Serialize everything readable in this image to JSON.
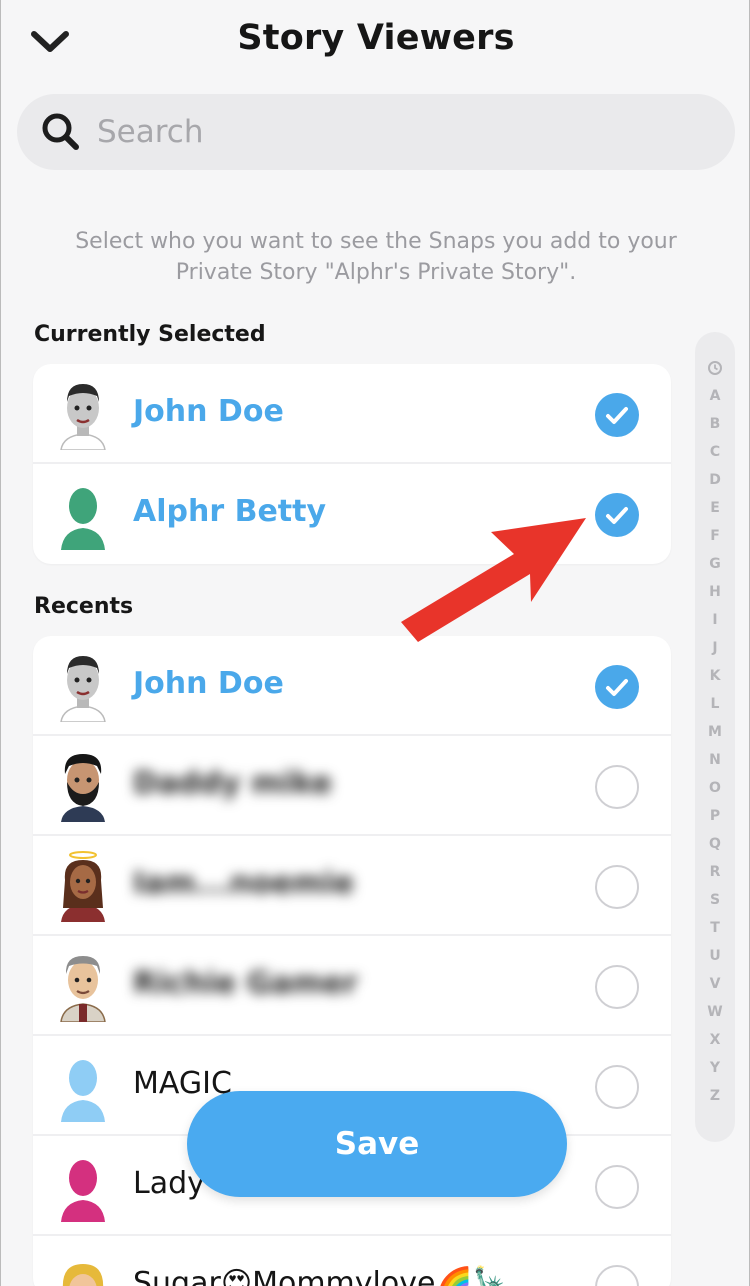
{
  "header": {
    "title": "Story Viewers"
  },
  "search": {
    "placeholder": "Search",
    "value": ""
  },
  "description": "Select who you want to see the Snaps you add to your Private Story \"Alphr's Private Story\".",
  "sections": {
    "currently_selected": {
      "label": "Currently Selected",
      "items": [
        {
          "name": "John Doe",
          "checked": true,
          "avatar": "bitmoji-man-icon"
        },
        {
          "name": "Alphr Betty",
          "checked": true,
          "avatar": "silhouette-green-icon"
        }
      ]
    },
    "recents": {
      "label": "Recents",
      "items": [
        {
          "name": "John Doe",
          "checked": true,
          "avatar": "bitmoji-man-icon"
        },
        {
          "name": "Daddy mike",
          "checked": false,
          "blurred": true,
          "avatar": "bitmoji-beard-icon"
        },
        {
          "name": "Iam...noemie",
          "checked": false,
          "blurred": true,
          "avatar": "bitmoji-woman-halo-icon"
        },
        {
          "name": "Richie Gamer",
          "checked": false,
          "blurred": true,
          "avatar": "bitmoji-grey-hair-icon"
        },
        {
          "name": "MAGIC",
          "checked": false,
          "avatar": "silhouette-blue-icon"
        },
        {
          "name": "Lady",
          "checked": false,
          "avatar": "silhouette-pink-icon"
        },
        {
          "name": "Sugar😍Mommylove🌈🗽",
          "checked": false,
          "avatar": "bitmoji-blonde-icon"
        }
      ]
    }
  },
  "index_bar": [
    "clock",
    "A",
    "B",
    "C",
    "D",
    "E",
    "F",
    "G",
    "H",
    "I",
    "J",
    "K",
    "L",
    "M",
    "N",
    "O",
    "P",
    "Q",
    "R",
    "S",
    "T",
    "U",
    "V",
    "W",
    "X",
    "Y",
    "Z"
  ],
  "save_label": "Save",
  "colors": {
    "accent": "#4aa8ea",
    "save": "#4aaaf0",
    "arrow": "#e8342a"
  }
}
